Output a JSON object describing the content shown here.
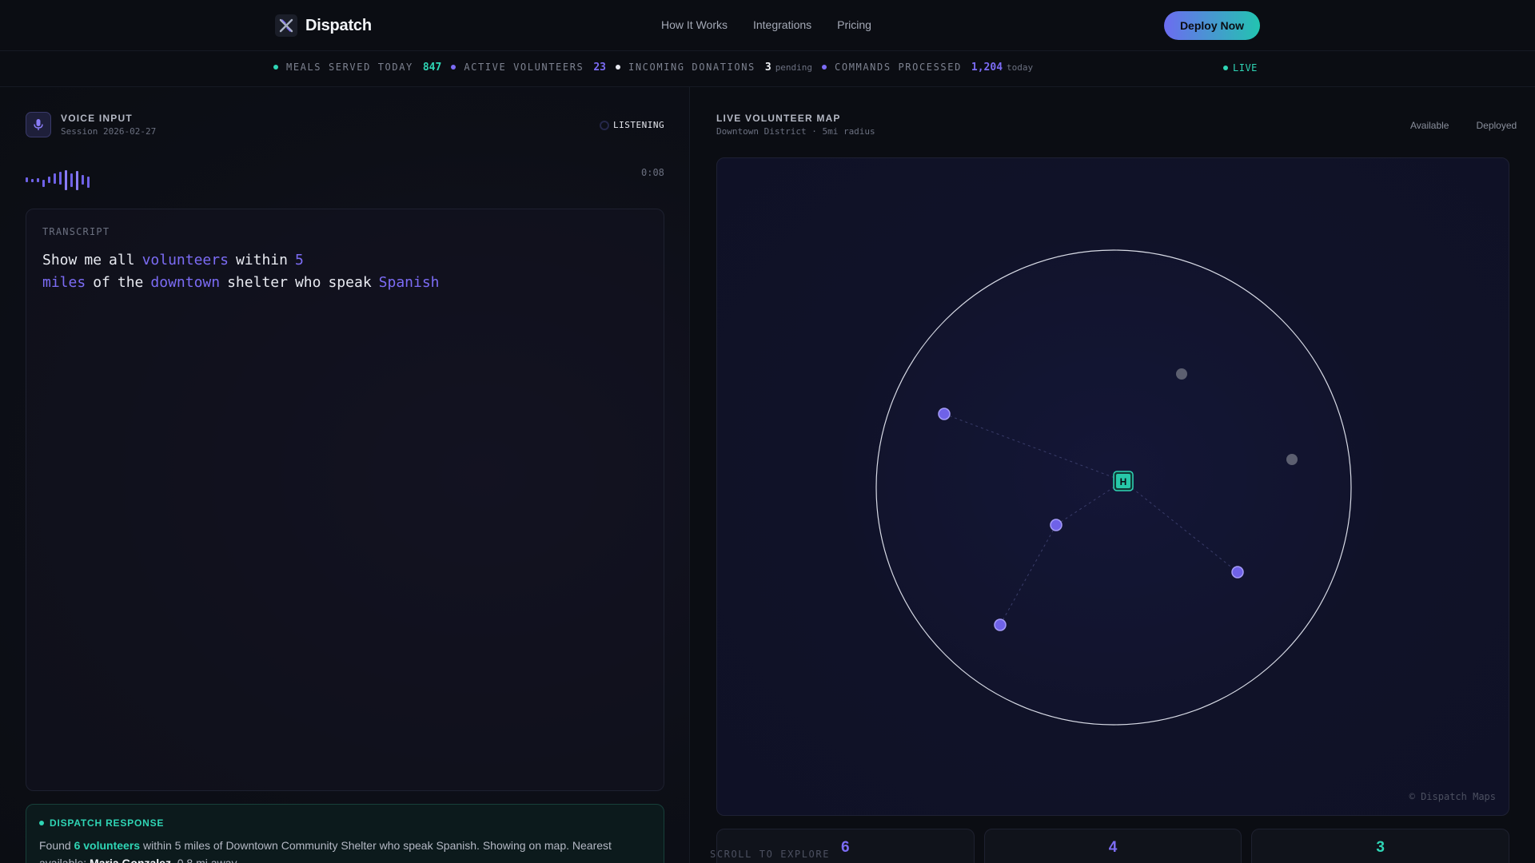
{
  "app": {
    "name": "Dispatch",
    "logo_icon": "dispatch-logo-icon"
  },
  "nav": {
    "items": [
      "How It Works",
      "Integrations",
      "Pricing"
    ],
    "cta": "Deploy Now"
  },
  "colors": {
    "accent": "#7c6cf5",
    "teal": "#2fd5b5",
    "muted": "#6b7080"
  },
  "stats": [
    {
      "label": "MEALS SERVED TODAY",
      "value": "847",
      "sub": "",
      "dot": "#2fd5b5",
      "color": "#2fd5b5"
    },
    {
      "label": "ACTIVE VOLUNTEERS",
      "value": "23",
      "sub": "",
      "dot": "#7c6cf5",
      "color": "#7c6cf5"
    },
    {
      "label": "INCOMING DONATIONS",
      "value": "3",
      "sub": "pending",
      "dot": "#e8eaf1",
      "color": "#f2f4f8"
    },
    {
      "label": "COMMANDS PROCESSED",
      "value": "1,204",
      "sub": "today",
      "dot": "#7c6cf5",
      "color": "#7c6cf5"
    }
  ],
  "live": "LIVE",
  "voice": {
    "title": "VOICE INPUT",
    "session": "Session 2026-02-27",
    "status": "LISTENING",
    "timer": "0:08"
  },
  "transcript": {
    "label": "TRANSCRIPT",
    "words": [
      {
        "t": "Show",
        "hl": false
      },
      {
        "t": "me",
        "hl": false
      },
      {
        "t": "all",
        "hl": false
      },
      {
        "t": "volunteers",
        "hl": true
      },
      {
        "t": "within",
        "hl": false
      },
      {
        "t": "5 miles",
        "hl": true
      },
      {
        "t": "of",
        "hl": false
      },
      {
        "t": "the",
        "hl": false
      },
      {
        "t": "downtown",
        "hl": true
      },
      {
        "t": "shelter",
        "hl": false
      },
      {
        "t": "who",
        "hl": false
      },
      {
        "t": "speak",
        "hl": false
      },
      {
        "t": "Spanish",
        "hl": true
      }
    ]
  },
  "response": {
    "title": "DISPATCH RESPONSE",
    "prefix": "Found ",
    "count": "6 volunteers",
    "middle": " within 5 miles of Downtown Community Shelter who speak Spanish. Showing on map. Nearest available: ",
    "nearest": "Maria Gonzalez",
    "suffix": ", 0.8 mi away."
  },
  "map": {
    "title": "LIVE VOLUNTEER MAP",
    "subtitle": "Downtown District · 5mi radius",
    "legend_available": "Available",
    "legend_deployed": "Deployed",
    "hub_label": "H",
    "copyright": "© Dispatch Maps"
  },
  "counts": [
    {
      "value": "6",
      "color": "#7c6cf5"
    },
    {
      "value": "4",
      "color": "#7c6cf5"
    },
    {
      "value": "3",
      "color": "#2fd5b5"
    }
  ],
  "scroll_hint": "SCROLL TO EXPLORE"
}
